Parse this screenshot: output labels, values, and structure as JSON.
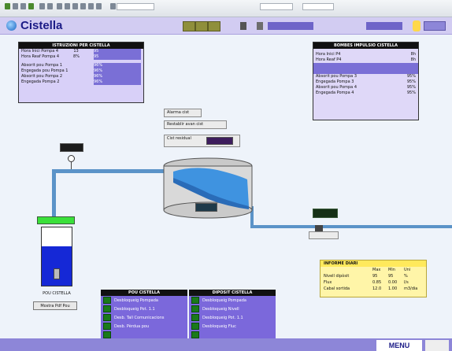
{
  "browser": {
    "address_text": "",
    "search_text": "",
    "zoom_text": ""
  },
  "header": {
    "title": "Cistella",
    "user_label": "",
    "date_label": ""
  },
  "left_panel": {
    "title": "ISTRUZIONI PER CISTELLA",
    "rows": [
      {
        "label": "Hora Inici Pompa 4",
        "v1": "13",
        "v2": "",
        "v3": "95"
      },
      {
        "label": "Hora Reaf Pompa 4",
        "v1": "8%",
        "v2": "",
        "v3": "95"
      },
      {
        "label": "Absorit pou Pompa 1",
        "v1": "",
        "v2": "",
        "v3": "96%"
      },
      {
        "label": "Engegada pou Pompa 1",
        "v1": "",
        "v2": "",
        "v3": "96%"
      },
      {
        "label": "Absorit pou Pompa 2",
        "v1": "",
        "v2": "",
        "v3": "96%"
      },
      {
        "label": "Engegada Pompa 2",
        "v1": "",
        "v2": "",
        "v3": "96%"
      }
    ]
  },
  "right_panel": {
    "title": "BOMBES IMPULSIO CISTELLA",
    "rows": [
      {
        "label": "Hora Inici P4",
        "v": "8h"
      },
      {
        "label": "Hora Reaf P4",
        "v": "8h"
      },
      {
        "label": "",
        "v": ""
      },
      {
        "label": "",
        "v": ""
      },
      {
        "label": "Absorit pou Pompa 3",
        "v": "95%"
      },
      {
        "label": "Engegada Pompa 3",
        "v": "95%"
      },
      {
        "label": "Absorit pou Pompa 4",
        "v": "95%"
      },
      {
        "label": "Engegada Pompa 4",
        "v": "95%"
      }
    ]
  },
  "center_controls": {
    "btn_alarm": "Alarma cist",
    "btn_reset": "Restablir avan cist",
    "consigna_label": "Cist residual",
    "consigna_value": ""
  },
  "digits": {
    "pressure": "",
    "tank": "",
    "flow": "",
    "level": ""
  },
  "left_tank": {
    "label": "POU CISTELLA",
    "button": "Mostra Pdf Pou"
  },
  "valve_label": "",
  "info": {
    "title": "INFORME DIARI",
    "col1": "Max",
    "col2": "Min",
    "col3": "Uni",
    "rows": [
      {
        "label": "Nivell dipòsit",
        "a": "95",
        "b": "95",
        "c": "%"
      },
      {
        "label": "Flux",
        "a": "0.85",
        "b": "0.00",
        "c": "l/s"
      },
      {
        "label": "Cabal sortida",
        "a": "12.0",
        "b": "1.00",
        "c": "m3/dia"
      }
    ]
  },
  "bottom_left": {
    "title": "POU CISTELLA",
    "items": [
      "Desbloqueig Pompada",
      "Desbloqueig Pot. 1.1",
      "Desb. Tall Comunicacions",
      "Desb. Pèrdua pou",
      ""
    ]
  },
  "bottom_right": {
    "title": "DIPOSIT CISTELLA",
    "items": [
      "Desbloqueig Pompada",
      "Desbloqueig Nivell",
      "Desbloqueig Pot. 1.1",
      "Desbloqueig Fluc",
      ""
    ]
  },
  "menu": {
    "label": "MENU",
    "extra": ""
  }
}
